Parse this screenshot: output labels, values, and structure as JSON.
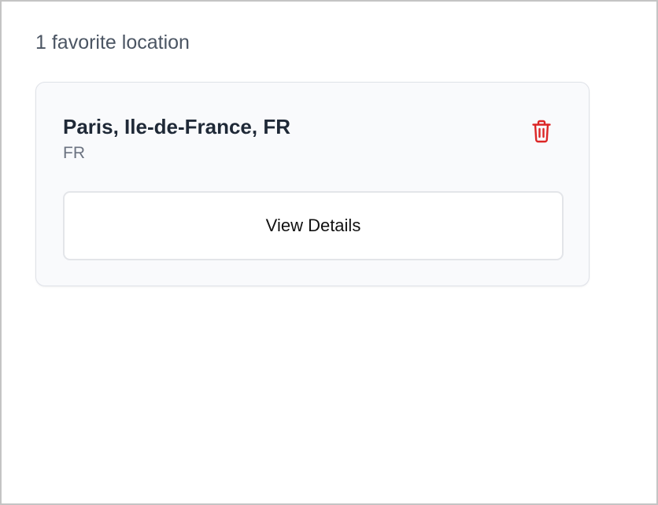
{
  "favorites": {
    "count_text": "1 favorite location",
    "items": [
      {
        "title": "Paris, Ile-de-France, FR",
        "subtitle": "FR",
        "action_label": "View Details",
        "delete_icon": "trash-icon"
      }
    ]
  },
  "colors": {
    "delete_icon": "#dc2626",
    "title_text": "#1f2937",
    "subtitle_text": "#6b7280",
    "count_text": "#4b5563",
    "card_background": "#f9fafc",
    "card_border": "#dfe2e8"
  }
}
